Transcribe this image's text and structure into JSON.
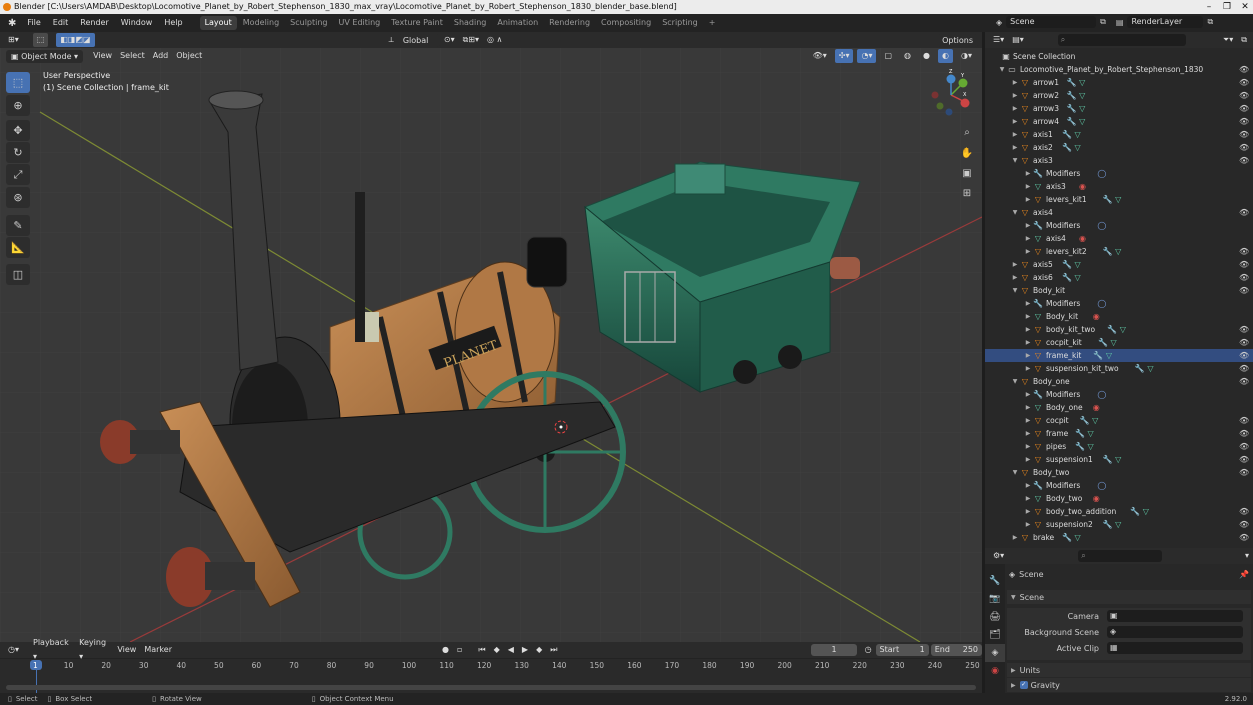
{
  "window": {
    "title": "Blender [C:\\Users\\AMDAB\\Desktop\\Locomotive_Planet_by_Robert_Stephenson_1830_max_vray\\Locomotive_Planet_by_Robert_Stephenson_1830_blender_base.blend]",
    "controls": [
      "–",
      "❐",
      "✕"
    ]
  },
  "menu": [
    "File",
    "Edit",
    "Render",
    "Window",
    "Help"
  ],
  "workspaces": [
    "Layout",
    "Modeling",
    "Sculpting",
    "UV Editing",
    "Texture Paint",
    "Shading",
    "Animation",
    "Rendering",
    "Compositing",
    "Scripting"
  ],
  "active_workspace": "Layout",
  "add_workspace": "+",
  "scene": {
    "name": "Scene",
    "render_layer": "RenderLayer"
  },
  "viewport": {
    "transform_orientation": "Global",
    "options_label": "Options",
    "mode": "Object Mode",
    "menus": [
      "View",
      "Select",
      "Add",
      "Object"
    ],
    "view_name": "User Perspective",
    "collection_info": "(1) Scene Collection | frame_kit",
    "plate_text": "PLANET",
    "gizmo": {
      "x": "X",
      "y": "Y",
      "z": "Z"
    },
    "accent": "#4772b3"
  },
  "outliner": {
    "title": "Scene Collection",
    "rows": [
      {
        "label": "Locomotive_Planet_by_Robert_Stephenson_1830",
        "depth": 1,
        "icon": "collection",
        "expanded": true,
        "eye": true
      },
      {
        "label": "arrow1",
        "depth": 2,
        "icon": "object",
        "mods": true,
        "eye": true
      },
      {
        "label": "arrow2",
        "depth": 2,
        "icon": "object",
        "mods": true,
        "eye": true
      },
      {
        "label": "arrow3",
        "depth": 2,
        "icon": "object",
        "mods": true,
        "eye": true
      },
      {
        "label": "arrow4",
        "depth": 2,
        "icon": "object",
        "mods": true,
        "eye": true
      },
      {
        "label": "axis1",
        "depth": 2,
        "icon": "object",
        "mods": true,
        "eye": true
      },
      {
        "label": "axis2",
        "depth": 2,
        "icon": "object",
        "mods": true,
        "eye": true
      },
      {
        "label": "axis3",
        "depth": 2,
        "icon": "object",
        "expanded": true,
        "eye": true
      },
      {
        "label": "Modifiers",
        "depth": 3,
        "icon": "wrench",
        "extra": "modifier"
      },
      {
        "label": "axis3",
        "depth": 3,
        "icon": "mesh",
        "extra": "material"
      },
      {
        "label": "levers_kit1",
        "depth": 3,
        "icon": "object",
        "mods": true
      },
      {
        "label": "axis4",
        "depth": 2,
        "icon": "object",
        "expanded": true,
        "eye": true
      },
      {
        "label": "Modifiers",
        "depth": 3,
        "icon": "wrench",
        "extra": "modifier"
      },
      {
        "label": "axis4",
        "depth": 3,
        "icon": "mesh",
        "extra": "material"
      },
      {
        "label": "levers_kit2",
        "depth": 3,
        "icon": "object",
        "mods": true,
        "eye": true
      },
      {
        "label": "axis5",
        "depth": 2,
        "icon": "object",
        "mods": true,
        "eye": true
      },
      {
        "label": "axis6",
        "depth": 2,
        "icon": "object",
        "mods": true,
        "eye": true
      },
      {
        "label": "Body_kit",
        "depth": 2,
        "icon": "object",
        "expanded": true,
        "eye": true
      },
      {
        "label": "Modifiers",
        "depth": 3,
        "icon": "wrench",
        "extra": "modifier"
      },
      {
        "label": "Body_kit",
        "depth": 3,
        "icon": "mesh",
        "extra": "material"
      },
      {
        "label": "body_kit_two",
        "depth": 3,
        "icon": "object",
        "mods": true,
        "eye": true
      },
      {
        "label": "cocpit_kit",
        "depth": 3,
        "icon": "object",
        "mods": true,
        "eye": true
      },
      {
        "label": "frame_kit",
        "depth": 3,
        "icon": "object",
        "mods": true,
        "eye": true,
        "selected": true
      },
      {
        "label": "suspension_kit_two",
        "depth": 3,
        "icon": "object",
        "mods": true,
        "eye": true
      },
      {
        "label": "Body_one",
        "depth": 2,
        "icon": "object",
        "expanded": true,
        "eye": true
      },
      {
        "label": "Modifiers",
        "depth": 3,
        "icon": "wrench",
        "extra": "modifier"
      },
      {
        "label": "Body_one",
        "depth": 3,
        "icon": "mesh",
        "extra": "material"
      },
      {
        "label": "cocpit",
        "depth": 3,
        "icon": "object",
        "mods": true,
        "eye": true
      },
      {
        "label": "frame",
        "depth": 3,
        "icon": "object",
        "mods": true,
        "eye": true
      },
      {
        "label": "pipes",
        "depth": 3,
        "icon": "object",
        "mods": true,
        "eye": true
      },
      {
        "label": "suspension1",
        "depth": 3,
        "icon": "object",
        "mods": true,
        "eye": true
      },
      {
        "label": "Body_two",
        "depth": 2,
        "icon": "object",
        "expanded": true,
        "eye": true
      },
      {
        "label": "Modifiers",
        "depth": 3,
        "icon": "wrench",
        "extra": "modifier"
      },
      {
        "label": "Body_two",
        "depth": 3,
        "icon": "mesh",
        "extra": "material"
      },
      {
        "label": "body_two_addition",
        "depth": 3,
        "icon": "object",
        "mods": true,
        "eye": true
      },
      {
        "label": "suspension2",
        "depth": 3,
        "icon": "object",
        "mods": true,
        "eye": true
      },
      {
        "label": "brake",
        "depth": 2,
        "icon": "object",
        "mods": true,
        "eye": true
      }
    ]
  },
  "properties": {
    "context": "Scene",
    "panel": "Scene",
    "fields": [
      {
        "label": "Camera",
        "value": ""
      },
      {
        "label": "Background Scene",
        "value": ""
      },
      {
        "label": "Active Clip",
        "value": ""
      }
    ],
    "subpanels": [
      "Units",
      "Gravity"
    ],
    "gravity_checked": true
  },
  "timeline": {
    "menus": [
      "Playback",
      "Keying",
      "View",
      "Marker"
    ],
    "current_frame": "1",
    "start_label": "Start",
    "start": "1",
    "end_label": "End",
    "end": "250",
    "ticks": [
      "1",
      "10",
      "20",
      "30",
      "40",
      "50",
      "60",
      "70",
      "80",
      "90",
      "100",
      "110",
      "120",
      "130",
      "140",
      "150",
      "160",
      "170",
      "180",
      "190",
      "200",
      "210",
      "220",
      "230",
      "240",
      "250"
    ],
    "playhead_frame": 1,
    "range": [
      1,
      250
    ]
  },
  "status": {
    "items": [
      "Select",
      "Box Select",
      "Rotate View",
      "Object Context Menu"
    ],
    "version": "2.92.0"
  }
}
